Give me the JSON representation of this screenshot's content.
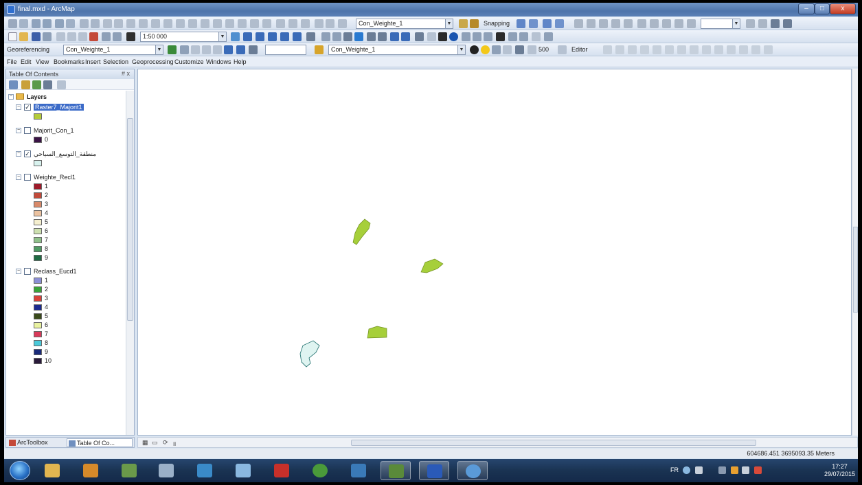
{
  "window": {
    "title": "final.mxd - ArcMap",
    "controls": {
      "minimize": "–",
      "maximize": "□",
      "close": "x"
    }
  },
  "toolbars": {
    "layer_combo_1": "Con_Weighte_1",
    "snapping_label": "Snapping",
    "scale_value": "1:50 000",
    "georef_label": "Georeferencing",
    "georef_layer": "Con_Weighte_1",
    "layer_combo_2": "Con_Weighte_1",
    "resolution_value": "500",
    "editor_label": "Editor"
  },
  "menu": [
    "File",
    "Edit",
    "View",
    "Bookmarks",
    "Insert",
    "Selection",
    "Geoprocessing",
    "Customize",
    "Windows",
    "Help"
  ],
  "toc": {
    "title": "Table Of Contents",
    "header_controls": "# x",
    "root_label": "Layers",
    "layers": [
      {
        "name": "Raster7_Majorit1",
        "checked": true,
        "selected": true,
        "classes": [
          {
            "label": "",
            "color": "#b5cc3a"
          }
        ]
      },
      {
        "name": "Majorit_Con_1",
        "checked": false,
        "classes": [
          {
            "label": "0",
            "color": "#3a1345"
          }
        ]
      },
      {
        "name": "منطقة_التوسع_السياحي",
        "checked": true,
        "classes": [
          {
            "label": "",
            "color": "#d8f2ee"
          }
        ]
      },
      {
        "name": "Weighte_Recl1",
        "checked": false,
        "classes": [
          {
            "label": "1",
            "color": "#9e1a2a"
          },
          {
            "label": "2",
            "color": "#c24a3a"
          },
          {
            "label": "3",
            "color": "#d98a6a"
          },
          {
            "label": "4",
            "color": "#ebc2a0"
          },
          {
            "label": "5",
            "color": "#f5efcf"
          },
          {
            "label": "6",
            "color": "#cde0b0"
          },
          {
            "label": "7",
            "color": "#8fc08a"
          },
          {
            "label": "8",
            "color": "#4f9a63"
          },
          {
            "label": "9",
            "color": "#1f6a43"
          }
        ]
      },
      {
        "name": "Reclass_Eucd1",
        "checked": false,
        "classes": [
          {
            "label": "1",
            "color": "#8c8fd6"
          },
          {
            "label": "2",
            "color": "#3aa33a"
          },
          {
            "label": "3",
            "color": "#d9413a"
          },
          {
            "label": "4",
            "color": "#1b2a8f"
          },
          {
            "label": "5",
            "color": "#3a4a1a"
          },
          {
            "label": "6",
            "color": "#e9f2a0"
          },
          {
            "label": "7",
            "color": "#d93a5a"
          },
          {
            "label": "8",
            "color": "#4ac9d9"
          },
          {
            "label": "9",
            "color": "#1a2a7a"
          },
          {
            "label": "10",
            "color": "#2a1a3a"
          }
        ]
      }
    ],
    "bottom_tabs": [
      "ArcToolbox",
      "Table Of Co..."
    ]
  },
  "map": {
    "polygon_fill": "#a6cf3a",
    "tourism_fill": "#dff4f1"
  },
  "status": {
    "coordinates": "604686.451  3695093.35 Meters"
  },
  "taskbar": {
    "language": "FR",
    "time": "17:27",
    "date": "29/07/2015"
  }
}
